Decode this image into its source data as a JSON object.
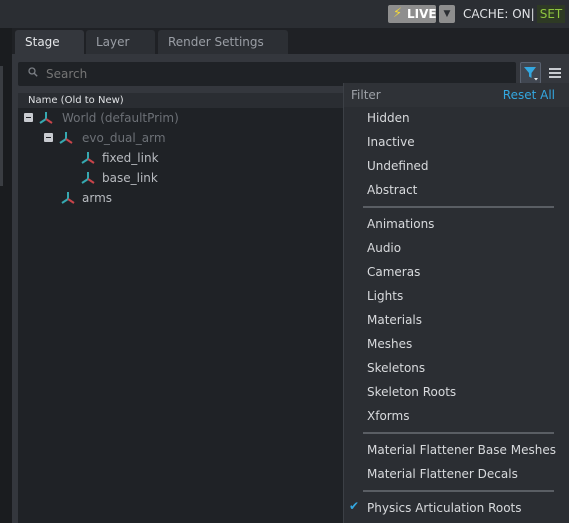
{
  "topbar": {
    "live_label": "LIVE",
    "cache_label": "CACHE: ON|",
    "set_label": "SET"
  },
  "tabs": [
    {
      "label": "Stage"
    },
    {
      "label": "Layer"
    },
    {
      "label": "Render Settings"
    }
  ],
  "search": {
    "placeholder": "Search"
  },
  "tree": {
    "header": "Name (Old to New)",
    "items": [
      {
        "label": "World (defaultPrim)"
      },
      {
        "label": "evo_dual_arm"
      },
      {
        "label": "fixed_link"
      },
      {
        "label": "base_link"
      },
      {
        "label": "arms"
      }
    ]
  },
  "filter_menu": {
    "title": "Filter",
    "reset_label": "Reset All",
    "group1": [
      "Hidden",
      "Inactive",
      "Undefined",
      "Abstract"
    ],
    "group2": [
      "Animations",
      "Audio",
      "Cameras",
      "Lights",
      "Materials",
      "Meshes",
      "Skeletons",
      "Skeleton Roots",
      "Xforms"
    ],
    "group3": [
      "Material Flattener Base Meshes",
      "Material Flattener Decals"
    ],
    "group4": [
      "Physics Articulation Roots"
    ]
  },
  "colors": {
    "accent": "#33a7e0",
    "live_bolt": "#f2d63a",
    "set_green": "#8ec63f",
    "xform_icon_teal": "#36a8b0",
    "xform_icon_red": "#c8444a"
  }
}
